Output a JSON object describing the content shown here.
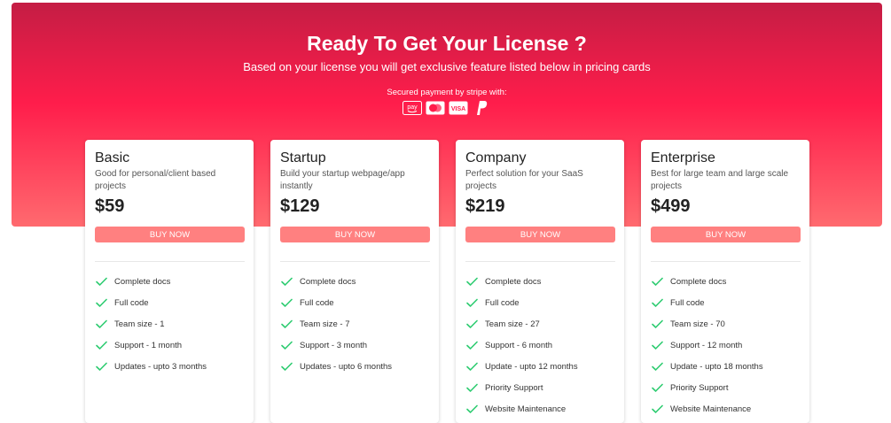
{
  "hero": {
    "title": "Ready To Get Your License ?",
    "subtitle": "Based on your license you will get exclusive feature listed below in pricing cards",
    "payment_label": "Secured payment by stripe with:",
    "payment_icons": [
      "amazon-pay-icon",
      "mastercard-icon",
      "visa-icon",
      "paypal-icon"
    ],
    "amazon_pay_text": "pay",
    "visa_text": "VISA"
  },
  "colors": {
    "hero_top": "#c41d44",
    "hero_mid": "#ff1d4b",
    "hero_bottom": "#ff6a6f",
    "button": "#ff8080",
    "check": "#2ecc71"
  },
  "plans": [
    {
      "name": "Basic",
      "description": "Good for personal/client based projects",
      "price": "$59",
      "button": "BUY NOW",
      "features": [
        "Complete docs",
        "Full code",
        "Team size - 1",
        "Support - 1 month",
        "Updates - upto 3 months"
      ]
    },
    {
      "name": "Startup",
      "description": "Build your startup webpage/app instantly",
      "price": "$129",
      "button": "BUY NOW",
      "features": [
        "Complete docs",
        "Full code",
        "Team size - 7",
        "Support - 3 month",
        "Updates - upto 6 months"
      ]
    },
    {
      "name": "Company",
      "description": "Perfect solution for your SaaS projects",
      "price": "$219",
      "button": "BUY NOW",
      "features": [
        "Complete docs",
        "Full code",
        "Team size - 27",
        "Support - 6 month",
        "Update - upto 12 months",
        "Priority Support",
        "Website Maintenance"
      ]
    },
    {
      "name": "Enterprise",
      "description": "Best for large team and large scale projects",
      "price": "$499",
      "button": "BUY NOW",
      "features": [
        "Complete docs",
        "Full code",
        "Team size - 70",
        "Support - 12 month",
        "Update - upto 18 months",
        "Priority Support",
        "Website Maintenance"
      ]
    }
  ]
}
